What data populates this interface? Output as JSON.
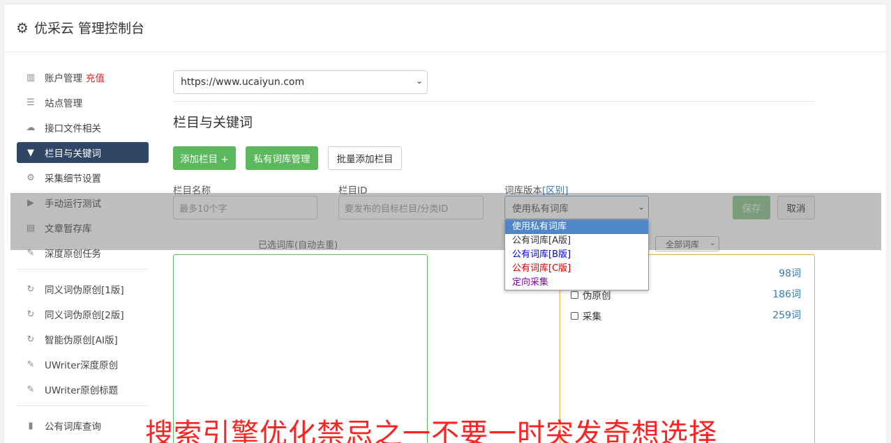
{
  "header": {
    "title": "优采云 管理控制台",
    "icon": "gear-icon"
  },
  "sidebar": {
    "items": [
      {
        "label": "账户管理",
        "icon": "bar-chart-icon",
        "badge": "充值"
      },
      {
        "label": "站点管理",
        "icon": "server-icon"
      },
      {
        "label": "接口文件相关",
        "icon": "cloud-upload-icon"
      },
      {
        "label": "栏目与关键词",
        "icon": "filter-icon",
        "active": true
      },
      {
        "label": "采集细节设置",
        "icon": "cogs-icon"
      },
      {
        "label": "手动运行测试",
        "icon": "play-circle-icon"
      },
      {
        "label": "文章暂存库",
        "icon": "database-icon"
      },
      {
        "label": "深度原创任务",
        "icon": "edit-icon"
      }
    ],
    "items2": [
      {
        "label": "同义词伪原创[1版]",
        "icon": "refresh-icon"
      },
      {
        "label": "同义词伪原创[2版]",
        "icon": "refresh-icon"
      },
      {
        "label": "智能伪原创[AI版]",
        "icon": "refresh-icon"
      },
      {
        "label": "UWriter深度原创",
        "icon": "edit-icon"
      },
      {
        "label": "UWriter原创标题",
        "icon": "edit-icon"
      }
    ],
    "items3": [
      {
        "label": "公有词库查询",
        "icon": "book-icon"
      }
    ]
  },
  "main": {
    "site_select": "https://www.ucaiyun.com",
    "section_title": "栏目与关键词",
    "buttons": {
      "add_column": "添加栏目 +",
      "private_lib": "私有词库管理",
      "batch_add": "批量添加栏目"
    },
    "form": {
      "name_label": "栏目名称",
      "name_placeholder": "最多10个字",
      "id_label": "栏目ID",
      "id_placeholder": "要发布的目标栏目/分类ID",
      "version_label": "词库版本",
      "version_link": "[区别]",
      "version_value": "使用私有词库",
      "save": "保存",
      "cancel": "取消"
    },
    "selected_label": "已选词库(自动去重)",
    "all_libs": "全部词库",
    "libraries": [
      {
        "name": "",
        "count": "98词"
      },
      {
        "name": "伪原创",
        "count": "186词"
      },
      {
        "name": "采集",
        "count": "259词"
      }
    ],
    "dropdown_options": [
      {
        "label": "使用私有词库",
        "color": "#ffffff"
      },
      {
        "label": "公有词库[A版]",
        "color": "#333333"
      },
      {
        "label": "公有词库[B版]",
        "color": "#0000cc"
      },
      {
        "label": "公有词库[C版]",
        "color": "#cc0000"
      },
      {
        "label": "定向采集",
        "color": "#8800aa"
      }
    ]
  },
  "banner": "搜索引擎优化禁忌之一不要一时突发奇想选择"
}
